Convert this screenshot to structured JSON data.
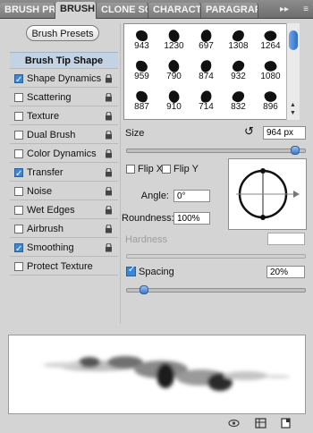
{
  "tabs": [
    "BRUSH PRE",
    "BRUSH",
    "CLONE SOU",
    "CHARACTE",
    "PARAGRAPI"
  ],
  "tab_overflow": "▸▸",
  "tab_menu": "≡",
  "brush_presets_label": "Brush Presets",
  "options_header": "Brush Tip Shape",
  "options": [
    {
      "label": "Shape Dynamics",
      "checked": true
    },
    {
      "label": "Scattering",
      "checked": false
    },
    {
      "label": "Texture",
      "checked": false
    },
    {
      "label": "Dual Brush",
      "checked": false
    },
    {
      "label": "Color Dynamics",
      "checked": false
    },
    {
      "label": "Transfer",
      "checked": true
    },
    {
      "label": "Noise",
      "checked": false
    },
    {
      "label": "Wet Edges",
      "checked": false
    },
    {
      "label": "Airbrush",
      "checked": false
    },
    {
      "label": "Smoothing",
      "checked": true
    },
    {
      "label": "Protect Texture",
      "checked": false
    }
  ],
  "brush_sizes": [
    "943",
    "1230",
    "697",
    "1308",
    "1264",
    "959",
    "790",
    "874",
    "932",
    "1080",
    "887",
    "910",
    "714",
    "832",
    "896"
  ],
  "size_label": "Size",
  "size_value": "964 px",
  "size_slider_fraction": 0.95,
  "flip_x_label": "Flip X",
  "flip_y_label": "Flip Y",
  "angle_label": "Angle:",
  "angle_value": "0°",
  "roundness_label": "Roundness:",
  "roundness_value": "100%",
  "hardness_label": "Hardness",
  "spacing_label": "Spacing",
  "spacing_value": "20%",
  "spacing_checked": true,
  "spacing_slider_fraction": 0.1
}
